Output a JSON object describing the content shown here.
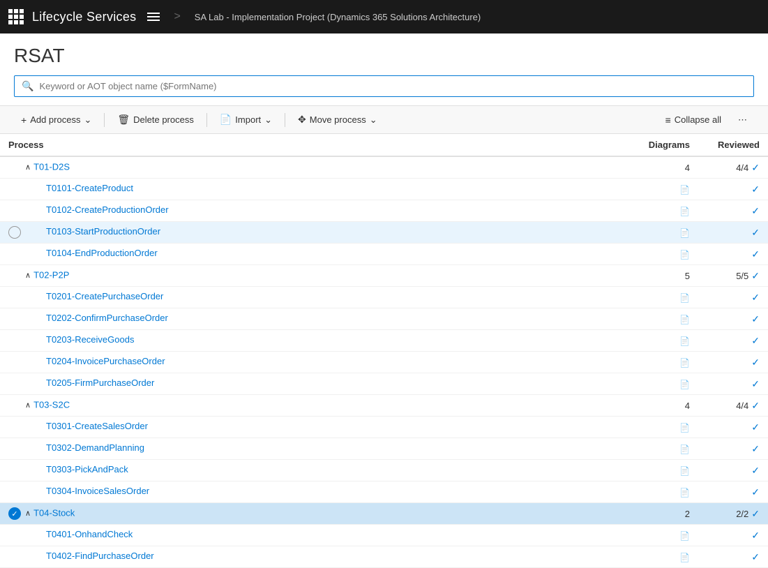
{
  "header": {
    "app_title": "Lifecycle Services",
    "breadcrumb": "SA Lab - Implementation Project (Dynamics 365 Solutions Architecture)"
  },
  "page": {
    "title": "RSAT"
  },
  "search": {
    "placeholder": "Keyword or AOT object name ($FormName)"
  },
  "toolbar": {
    "add_process": "Add process",
    "delete_process": "Delete process",
    "import": "Import",
    "move_process": "Move process",
    "collapse_all": "Collapse all"
  },
  "table": {
    "columns": {
      "process": "Process",
      "diagrams": "Diagrams",
      "reviewed": "Reviewed"
    },
    "rows": [
      {
        "id": "T01-D2S",
        "type": "group",
        "name": "T01-D2S",
        "diagrams": "4",
        "reviewed": "4/4",
        "reviewed_check": true,
        "expanded": true,
        "selected": false,
        "checkbox": false
      },
      {
        "id": "T0101",
        "type": "item",
        "name": "T0101-CreateProduct",
        "diagrams": "diagram",
        "reviewed": "",
        "reviewed_check": true,
        "selected": false,
        "checkbox": false
      },
      {
        "id": "T0102",
        "type": "item",
        "name": "T0102-CreateProductionOrder",
        "diagrams": "diagram",
        "reviewed": "",
        "reviewed_check": true,
        "selected": false,
        "checkbox": false
      },
      {
        "id": "T0103",
        "type": "item",
        "name": "T0103-StartProductionOrder",
        "diagrams": "diagram",
        "reviewed": "",
        "reviewed_check": true,
        "selected": true,
        "checkbox": "empty"
      },
      {
        "id": "T0104",
        "type": "item",
        "name": "T0104-EndProductionOrder",
        "diagrams": "diagram",
        "reviewed": "",
        "reviewed_check": true,
        "selected": false,
        "checkbox": false
      },
      {
        "id": "T02-P2P",
        "type": "group",
        "name": "T02-P2P",
        "diagrams": "5",
        "reviewed": "5/5",
        "reviewed_check": true,
        "expanded": true,
        "selected": false,
        "checkbox": false
      },
      {
        "id": "T0201",
        "type": "item",
        "name": "T0201-CreatePurchaseOrder",
        "diagrams": "diagram",
        "reviewed": "",
        "reviewed_check": true,
        "selected": false,
        "checkbox": false
      },
      {
        "id": "T0202",
        "type": "item",
        "name": "T0202-ConfirmPurchaseOrder",
        "diagrams": "diagram",
        "reviewed": "",
        "reviewed_check": true,
        "selected": false,
        "checkbox": false
      },
      {
        "id": "T0203",
        "type": "item",
        "name": "T0203-ReceiveGoods",
        "diagrams": "diagram",
        "reviewed": "",
        "reviewed_check": true,
        "selected": false,
        "checkbox": false
      },
      {
        "id": "T0204",
        "type": "item",
        "name": "T0204-InvoicePurchaseOrder",
        "diagrams": "diagram",
        "reviewed": "",
        "reviewed_check": true,
        "selected": false,
        "checkbox": false
      },
      {
        "id": "T0205",
        "type": "item",
        "name": "T0205-FirmPurchaseOrder",
        "diagrams": "diagram",
        "reviewed": "",
        "reviewed_check": true,
        "selected": false,
        "checkbox": false
      },
      {
        "id": "T03-S2C",
        "type": "group",
        "name": "T03-S2C",
        "diagrams": "4",
        "reviewed": "4/4",
        "reviewed_check": true,
        "expanded": true,
        "selected": false,
        "checkbox": false
      },
      {
        "id": "T0301",
        "type": "item",
        "name": "T0301-CreateSalesOrder",
        "diagrams": "diagram",
        "reviewed": "",
        "reviewed_check": true,
        "selected": false,
        "checkbox": false
      },
      {
        "id": "T0302",
        "type": "item",
        "name": "T0302-DemandPlanning",
        "diagrams": "diagram",
        "reviewed": "",
        "reviewed_check": true,
        "selected": false,
        "checkbox": false
      },
      {
        "id": "T0303",
        "type": "item",
        "name": "T0303-PickAndPack",
        "diagrams": "diagram",
        "reviewed": "",
        "reviewed_check": true,
        "selected": false,
        "checkbox": false
      },
      {
        "id": "T0304",
        "type": "item",
        "name": "T0304-InvoiceSalesOrder",
        "diagrams": "diagram",
        "reviewed": "",
        "reviewed_check": true,
        "selected": false,
        "checkbox": false
      },
      {
        "id": "T04-Stock",
        "type": "group",
        "name": "T04-Stock",
        "diagrams": "2",
        "reviewed": "2/2",
        "reviewed_check": true,
        "expanded": true,
        "selected": true,
        "checkbox": "checked"
      },
      {
        "id": "T0401",
        "type": "item",
        "name": "T0401-OnhandCheck",
        "diagrams": "diagram",
        "reviewed": "",
        "reviewed_check": true,
        "selected": false,
        "checkbox": false
      },
      {
        "id": "T0402",
        "type": "item",
        "name": "T0402-FindPurchaseOrder",
        "diagrams": "diagram",
        "reviewed": "",
        "reviewed_check": true,
        "selected": false,
        "checkbox": false
      }
    ]
  }
}
